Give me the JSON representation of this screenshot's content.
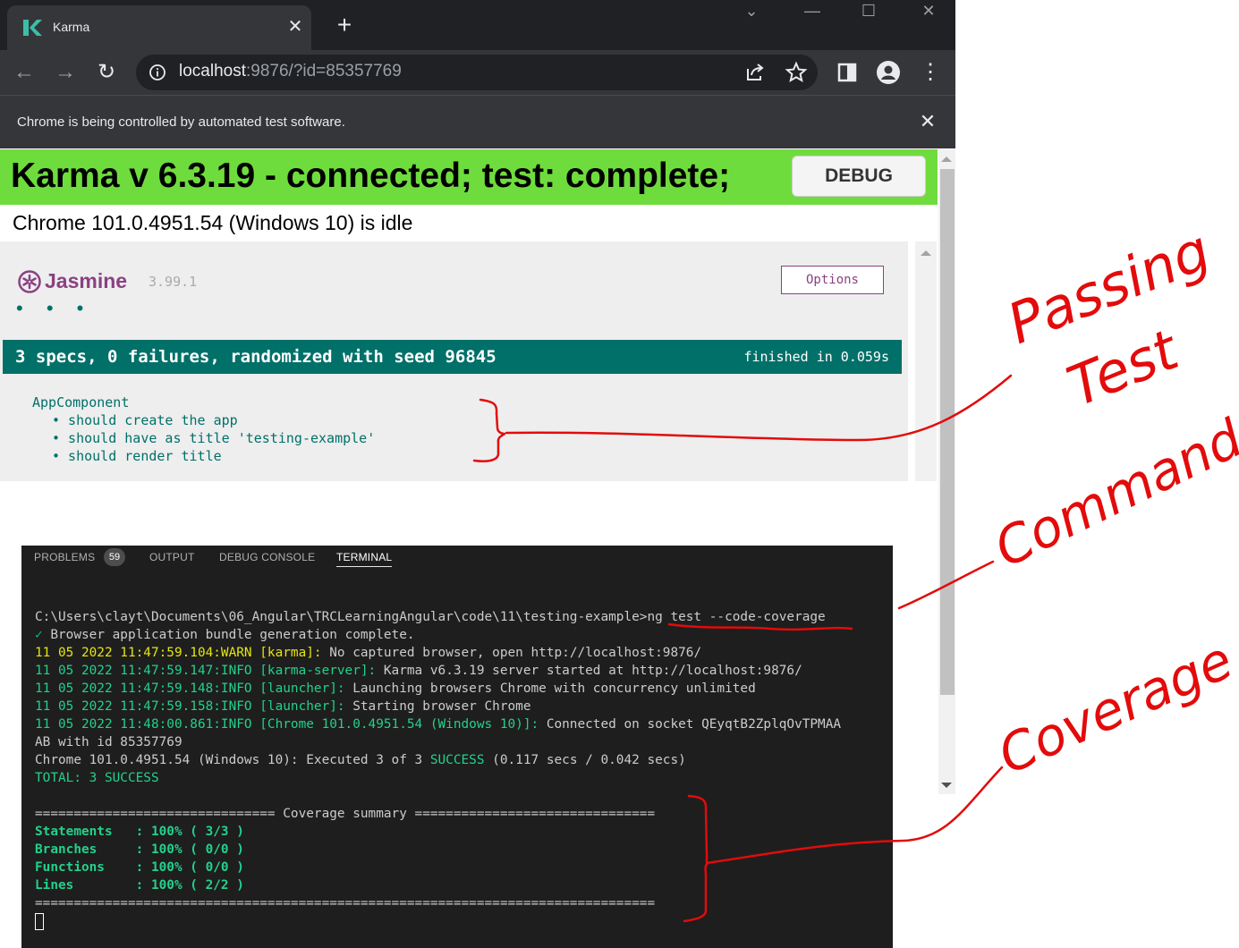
{
  "browser": {
    "tab_title": "Karma",
    "url_host": "localhost",
    "url_rest": ":9876/?id=85357769",
    "infobar_text": "Chrome is being controlled by automated test software.",
    "icons": [
      "karma-favicon",
      "close-icon",
      "plus-icon",
      "back-icon",
      "forward-icon",
      "reload-icon",
      "info-icon",
      "share-icon",
      "star-icon",
      "sidepanel-icon",
      "profile-icon",
      "menu-icon"
    ]
  },
  "karma": {
    "title": "Karma v 6.3.19 - connected; test: complete;",
    "debug_label": "DEBUG",
    "browser_status": "Chrome 101.0.4951.54 (Windows 10) is idle"
  },
  "jasmine": {
    "name": "Jasmine",
    "version": "3.99.1",
    "dots": "• • •",
    "options_label": "Options",
    "summary": "3 specs, 0 failures, randomized with seed 96845",
    "duration": "finished in 0.059s",
    "suite": "AppComponent",
    "specs": [
      "• should create the app",
      "• should have as title 'testing-example'",
      "• should render title"
    ],
    "accent": "#007069",
    "banner_color": "#6fdc3d"
  },
  "terminal": {
    "tabs": {
      "problems": "PROBLEMS",
      "problems_count": "59",
      "output": "OUTPUT",
      "debug_console": "DEBUG CONSOLE",
      "terminal": "TERMINAL"
    },
    "prompt": "C:\\Users\\clayt\\Documents\\06_Angular\\TRCLearningAngular\\code\\11\\testing-example>",
    "command": "ng test --code-coverage",
    "bundle_check": "✓",
    "bundle": " Browser application bundle generation complete.",
    "log1_ts": "11 05 2022 11:47:59.104:WARN [karma]:",
    "log1_msg": " No captured browser, open http://localhost:9876/",
    "log2_ts": "11 05 2022 11:47:59.147:INFO [karma-server]:",
    "log2_msg": " Karma v6.3.19 server started at http://localhost:9876/",
    "log3_ts": "11 05 2022 11:47:59.148:INFO [launcher]:",
    "log3_msg": " Launching browsers Chrome with concurrency unlimited",
    "log4_ts": "11 05 2022 11:47:59.158:INFO [launcher]:",
    "log4_msg": " Starting browser Chrome",
    "log5_ts": "11 05 2022 11:48:00.861:INFO [Chrome 101.0.4951.54 (Windows 10)]:",
    "log5_msg": " Connected on socket QEyqtB2ZplqOvTPMAA",
    "log5_cont": "AB with id 85357769",
    "exec_pre": "Chrome 101.0.4951.54 (Windows 10): Executed 3 of 3 ",
    "exec_success": "SUCCESS",
    "exec_post": " (0.117 secs / 0.042 secs)",
    "total": "TOTAL: 3 SUCCESS",
    "coverage_header": "=============================== Coverage summary ===============================",
    "statements": "Statements   : 100% ( 3/3 )",
    "branches": "Branches     : 100% ( 0/0 )",
    "functions": "Functions    : 100% ( 0/0 )",
    "lines": "Lines        : 100% ( 2/2 )",
    "coverage_footer": "================================================================================"
  },
  "annotations": {
    "passing": "Passing",
    "test": "Test",
    "command": "Command",
    "coverage": "Coverage",
    "color": "#e30b0b"
  }
}
